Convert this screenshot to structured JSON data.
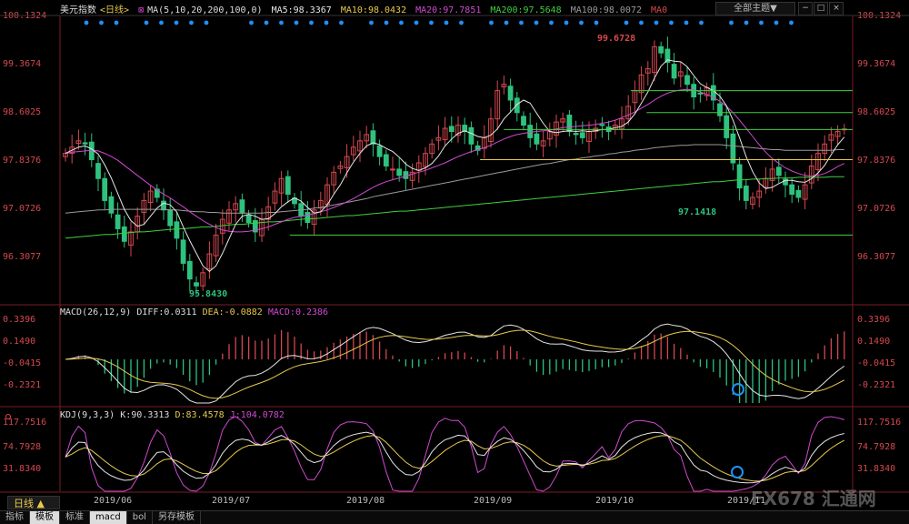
{
  "header": {
    "name": "美元指数",
    "period": "<日线>",
    "ma_label": "MA(5,10,20,200,100,0)",
    "ma_values": [
      {
        "label": "MA5:98.3367",
        "color": "#e6e6e6"
      },
      {
        "label": "MA10:98.0432",
        "color": "#e8c94c"
      },
      {
        "label": "MA20:97.7851",
        "color": "#d04ad0"
      },
      {
        "label": "MA200:97.5648",
        "color": "#3fcf3f"
      },
      {
        "label": "MA100:98.0072",
        "color": "#9a9a9a"
      },
      {
        "label": "MA0",
        "color": "#d5484e"
      }
    ],
    "theme_button": "全部主题▼"
  },
  "price_panel": {
    "y_ticks": [
      "100.1324",
      "99.3674",
      "98.6025",
      "97.8376",
      "97.0726",
      "96.3077"
    ],
    "high_label": "99.6728",
    "low_label_1": "95.8430",
    "low_label_2": "97.1418"
  },
  "macd_panel": {
    "title": "MACD(26,12,9)",
    "diff": "DIFF:0.0311",
    "dea": "DEA:-0.0882",
    "macd": "MACD:0.2386",
    "y_ticks": [
      "0.3396",
      "0.1490",
      "-0.0415",
      "-0.2321"
    ]
  },
  "kdj_panel": {
    "title": "KDJ(9,3,3)",
    "k": "K:90.3313",
    "d": "D:83.4578",
    "j": "J:104.0782",
    "y_ticks": [
      "117.7516",
      "74.7928",
      "31.8340"
    ]
  },
  "x_axis": [
    "2019/06",
    "2019/07",
    "2019/08",
    "2019/09",
    "2019/10",
    "2019/11"
  ],
  "bottom": {
    "period_button": "日线 ▲",
    "tabs": [
      "指标",
      "模板",
      "标准",
      "macd",
      "bol",
      "另存模板"
    ],
    "logo": "FX678 汇通网"
  },
  "colors": {
    "up": "#d5484e",
    "down": "#2ec27e",
    "ma5": "#e6e6e6",
    "ma10": "#e8c94c",
    "ma20": "#d04ad0",
    "ma200": "#3fcf3f",
    "ma100": "#9a9a9a",
    "highlight": "#1e90ff"
  },
  "chart_data": {
    "type": "candlestick",
    "title": "美元指数 <日线>",
    "x_range": [
      "2019/06",
      "2019/11"
    ],
    "ylim": [
      96.3077,
      100.1324
    ],
    "key_points": [
      {
        "label": "low",
        "value": 95.843
      },
      {
        "label": "high",
        "value": 99.6728
      },
      {
        "label": "low",
        "value": 97.1418
      }
    ],
    "close_series": [
      97.95,
      98.05,
      98.15,
      98.1,
      97.85,
      97.55,
      97.2,
      97.0,
      96.75,
      96.55,
      96.7,
      96.95,
      97.2,
      97.35,
      97.25,
      97.05,
      96.8,
      96.6,
      96.2,
      95.95,
      95.84,
      96.05,
      96.35,
      96.65,
      96.9,
      97.05,
      97.15,
      97.0,
      96.85,
      96.7,
      96.9,
      97.1,
      97.35,
      97.55,
      97.3,
      97.15,
      96.95,
      96.85,
      97.05,
      97.2,
      97.45,
      97.65,
      97.75,
      97.9,
      98.05,
      98.15,
      98.25,
      98.1,
      97.9,
      97.75,
      97.7,
      97.6,
      97.55,
      97.65,
      97.8,
      97.95,
      98.1,
      98.2,
      98.35,
      98.3,
      98.4,
      98.3,
      98.1,
      98.0,
      98.2,
      98.5,
      98.95,
      99.05,
      98.8,
      98.6,
      98.4,
      98.2,
      98.1,
      98.15,
      98.3,
      98.45,
      98.5,
      98.3,
      98.25,
      98.2,
      98.3,
      98.35,
      98.4,
      98.3,
      98.4,
      98.5,
      98.7,
      98.95,
      99.2,
      99.3,
      99.65,
      99.55,
      99.4,
      99.15,
      99.25,
      99.05,
      98.85,
      98.9,
      99.0,
      98.8,
      98.55,
      98.2,
      97.8,
      97.4,
      97.2,
      97.25,
      97.35,
      97.55,
      97.7,
      97.6,
      97.45,
      97.3,
      97.25,
      97.45,
      97.75,
      97.95,
      98.1,
      98.25,
      98.3,
      98.34
    ],
    "ma5": [
      97.95,
      98.0,
      98.05,
      98.07,
      98.02,
      97.94,
      97.77,
      97.56,
      97.31,
      97.06,
      96.88,
      96.79,
      96.82,
      96.95,
      97.08,
      97.16,
      97.13,
      97.02,
      96.78,
      96.56,
      96.36,
      96.16,
      96.07,
      96.16,
      96.36,
      96.59,
      96.82,
      96.95,
      96.98,
      96.95,
      96.9,
      96.91,
      96.99,
      97.1,
      97.18,
      97.24,
      97.19,
      97.09,
      97.0,
      97.02,
      97.13,
      97.3,
      97.45,
      97.64,
      97.81,
      97.95,
      98.07,
      98.12,
      98.09,
      98.03,
      97.98,
      97.89,
      97.78,
      97.71,
      97.68,
      97.72,
      97.79,
      97.91,
      98.07,
      98.18,
      98.27,
      98.31,
      98.27,
      98.22,
      98.2,
      98.24,
      98.34,
      98.5,
      98.61,
      98.73,
      98.8,
      98.75,
      98.59,
      98.43,
      98.3,
      98.28,
      98.3,
      98.31,
      98.3,
      98.31,
      98.3,
      98.31,
      98.33,
      98.33,
      98.36,
      98.38,
      98.45,
      98.58,
      98.75,
      98.93,
      99.15,
      99.34,
      99.44,
      99.42,
      99.41,
      99.33,
      99.19,
      99.06,
      99.0,
      98.95,
      98.86,
      98.71,
      98.48,
      98.2,
      97.9,
      97.66,
      97.48,
      97.39,
      97.41,
      97.47,
      97.52,
      97.52,
      97.5,
      97.49,
      97.55,
      97.64,
      97.76,
      97.93,
      98.09,
      98.21
    ],
    "ma20": [
      97.95,
      97.97,
      97.98,
      97.99,
      98.0,
      97.99,
      97.95,
      97.9,
      97.84,
      97.76,
      97.68,
      97.6,
      97.52,
      97.44,
      97.37,
      97.3,
      97.24,
      97.17,
      97.1,
      97.02,
      96.95,
      96.88,
      96.82,
      96.77,
      96.73,
      96.71,
      96.7,
      96.7,
      96.71,
      96.73,
      96.75,
      96.78,
      96.82,
      96.86,
      96.9,
      96.93,
      96.95,
      96.97,
      96.99,
      97.02,
      97.05,
      97.09,
      97.13,
      97.18,
      97.23,
      97.29,
      97.35,
      97.41,
      97.46,
      97.5,
      97.53,
      97.56,
      97.59,
      97.62,
      97.65,
      97.68,
      97.72,
      97.76,
      97.8,
      97.85,
      97.9,
      97.94,
      97.98,
      98.01,
      98.04,
      98.08,
      98.13,
      98.18,
      98.22,
      98.25,
      98.27,
      98.29,
      98.3,
      98.31,
      98.32,
      98.34,
      98.36,
      98.37,
      98.38,
      98.39,
      98.4,
      98.41,
      98.43,
      98.45,
      98.48,
      98.52,
      98.56,
      98.61,
      98.67,
      98.73,
      98.8,
      98.86,
      98.91,
      98.94,
      98.96,
      98.97,
      98.96,
      98.93,
      98.89,
      98.84,
      98.78,
      98.7,
      98.6,
      98.48,
      98.35,
      98.22,
      98.09,
      97.97,
      97.87,
      97.79,
      97.72,
      97.67,
      97.63,
      97.6,
      97.59,
      97.6,
      97.63,
      97.68,
      97.74,
      97.79
    ],
    "ma100": [
      97.0,
      97.01,
      97.02,
      97.03,
      97.04,
      97.05,
      97.05,
      97.06,
      97.06,
      97.06,
      97.06,
      97.06,
      97.06,
      97.06,
      97.06,
      97.06,
      97.05,
      97.05,
      97.04,
      97.03,
      97.02,
      97.02,
      97.01,
      97.01,
      97.0,
      97.0,
      97.0,
      97.0,
      97.0,
      97.0,
      97.0,
      97.01,
      97.01,
      97.02,
      97.03,
      97.04,
      97.05,
      97.06,
      97.08,
      97.09,
      97.11,
      97.13,
      97.15,
      97.17,
      97.19,
      97.21,
      97.23,
      97.26,
      97.28,
      97.3,
      97.32,
      97.34,
      97.36,
      97.38,
      97.4,
      97.42,
      97.44,
      97.46,
      97.48,
      97.5,
      97.52,
      97.54,
      97.56,
      97.58,
      97.6,
      97.62,
      97.64,
      97.66,
      97.68,
      97.7,
      97.72,
      97.74,
      97.76,
      97.78,
      97.79,
      97.81,
      97.83,
      97.85,
      97.86,
      97.88,
      97.89,
      97.91,
      97.92,
      97.94,
      97.95,
      97.97,
      97.98,
      98.0,
      98.01,
      98.02,
      98.04,
      98.05,
      98.06,
      98.07,
      98.08,
      98.08,
      98.09,
      98.09,
      98.09,
      98.09,
      98.09,
      98.08,
      98.07,
      98.06,
      98.05,
      98.04,
      98.03,
      98.02,
      98.01,
      98.01,
      98.0,
      98.0,
      98.0,
      98.0,
      98.0,
      98.0,
      98.0,
      98.0,
      98.01,
      98.01
    ],
    "ma200": [
      96.6,
      96.61,
      96.62,
      96.63,
      96.64,
      96.65,
      96.66,
      96.66,
      96.67,
      96.68,
      96.69,
      96.7,
      96.7,
      96.71,
      96.72,
      96.73,
      96.74,
      96.75,
      96.75,
      96.76,
      96.77,
      96.78,
      96.78,
      96.79,
      96.8,
      96.81,
      96.82,
      96.82,
      96.83,
      96.84,
      96.85,
      96.86,
      96.86,
      96.87,
      96.88,
      96.89,
      96.9,
      96.91,
      96.91,
      96.92,
      96.93,
      96.94,
      96.95,
      96.96,
      96.96,
      96.97,
      96.98,
      96.99,
      97.0,
      97.01,
      97.02,
      97.03,
      97.03,
      97.04,
      97.05,
      97.06,
      97.07,
      97.08,
      97.09,
      97.1,
      97.11,
      97.12,
      97.13,
      97.14,
      97.15,
      97.16,
      97.17,
      97.18,
      97.19,
      97.2,
      97.21,
      97.22,
      97.23,
      97.24,
      97.25,
      97.26,
      97.27,
      97.28,
      97.29,
      97.3,
      97.31,
      97.32,
      97.33,
      97.34,
      97.35,
      97.36,
      97.37,
      97.38,
      97.39,
      97.4,
      97.41,
      97.42,
      97.43,
      97.44,
      97.45,
      97.46,
      97.47,
      97.48,
      97.49,
      97.5,
      97.5,
      97.51,
      97.52,
      97.53,
      97.53,
      97.54,
      97.54,
      97.55,
      97.55,
      97.56,
      97.56,
      97.56,
      97.57,
      97.57,
      97.57,
      97.57,
      97.57,
      97.58,
      97.58,
      97.58
    ],
    "support_resistance": [
      98.95,
      98.6,
      98.33,
      97.85,
      96.65
    ]
  }
}
